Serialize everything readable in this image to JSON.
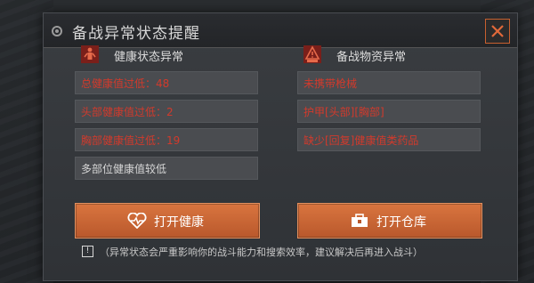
{
  "dialog": {
    "title": "备战异常状态提醒",
    "close_icon": "close-x-icon",
    "accent_color": "#d9753f",
    "alert_text_color": "#d23a2c"
  },
  "health": {
    "header": "健康状态异常",
    "icon": "health-alert-icon",
    "items": [
      "总健康值过低：48",
      "头部健康值过低：2",
      "胸部健康值过低：19",
      "多部位健康值较低"
    ],
    "button_label": "打开健康",
    "button_icon": "heart-pulse-icon"
  },
  "supplies": {
    "header": "备战物资异常",
    "icon": "supply-alert-icon",
    "items": [
      "未携带枪械",
      "护甲[头部][胸部]",
      "缺少[回复]健康值类药品"
    ],
    "button_label": "打开仓库",
    "button_icon": "toolbox-icon"
  },
  "notice": {
    "icon_char": "!",
    "text": "（异常状态会严重影响你的战斗能力和搜索效率，建议解决后再进入战斗）"
  }
}
